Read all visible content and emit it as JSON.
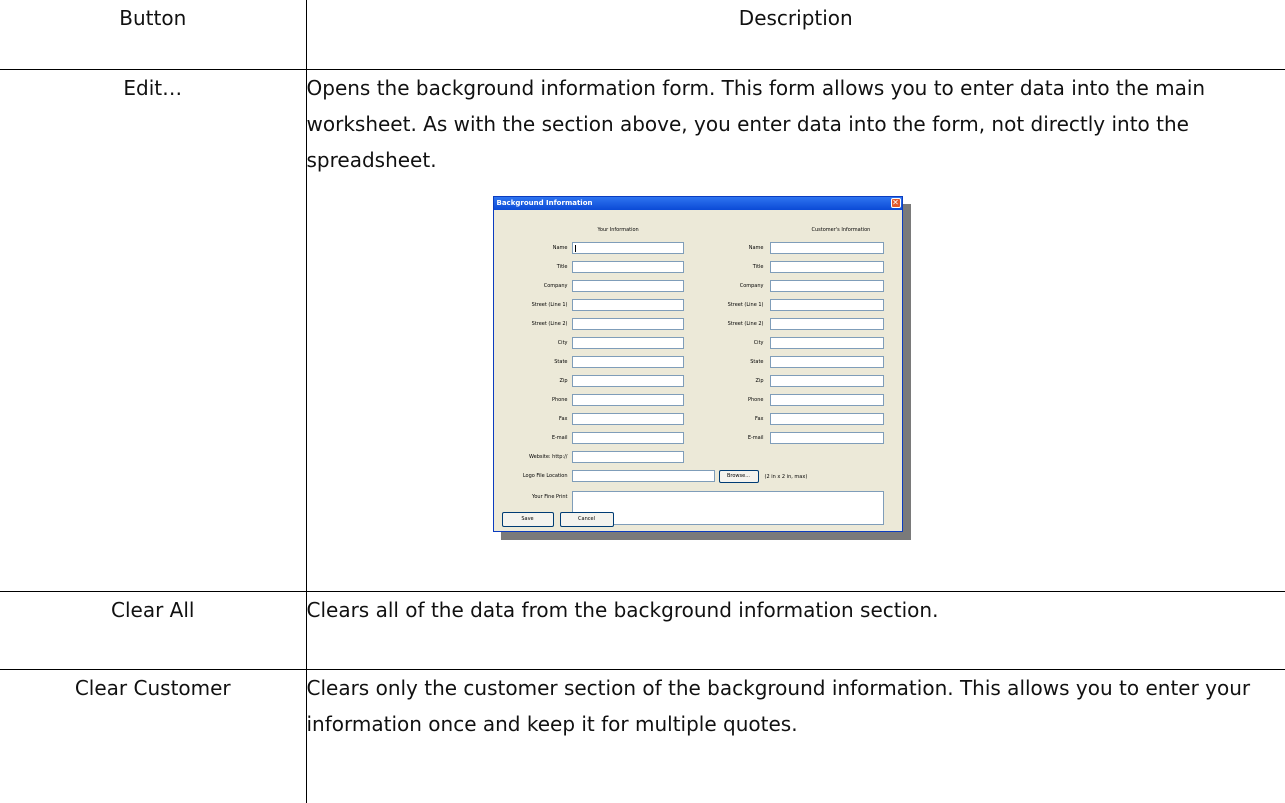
{
  "table": {
    "headers": {
      "button": "Button",
      "description": "Description"
    },
    "rows": [
      {
        "button": "Edit…",
        "description": "Opens the background information form.  This form allows you to enter data into the main worksheet.  As with the section above, you enter data into the form, not directly into the spreadsheet."
      },
      {
        "button": "Clear All",
        "description": "Clears all of the data from the background information section."
      },
      {
        "button": "Clear Customer",
        "description": "Clears only the customer section of the background information.  This allows you to enter your information once and keep it for multiple quotes."
      }
    ]
  },
  "dialog": {
    "title": "Background Information",
    "close_glyph": "✕",
    "your_info_header": "Your Information",
    "customer_info_header": "Customer's Information",
    "fields": [
      "Name",
      "Title",
      "Company",
      "Street (Line 1)",
      "Street (Line 2)",
      "City",
      "State",
      "Zip",
      "Phone",
      "Fax",
      "E-mail"
    ],
    "website_label": "Website:  http://",
    "logo_label": "Logo File Location",
    "browse_label": "Browse...",
    "logo_note": "(2 in x 2 in, max)",
    "fine_print_label": "Your Fine Print",
    "save_label": "Save",
    "cancel_label": "Cancel"
  }
}
